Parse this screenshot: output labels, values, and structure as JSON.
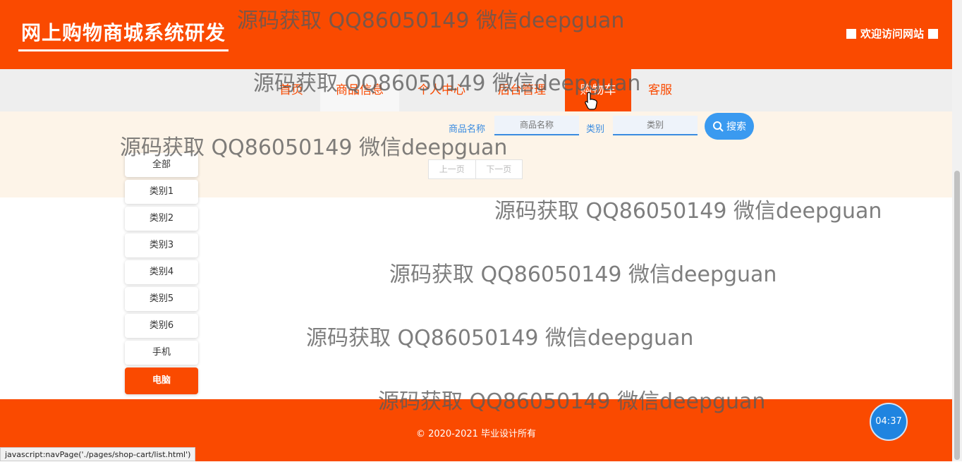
{
  "header": {
    "site_title": "网上购物商城系统研发",
    "welcome": "欢迎访问网站"
  },
  "nav": {
    "items": [
      {
        "label": "首页"
      },
      {
        "label": "商品信息"
      },
      {
        "label": "个人中心"
      },
      {
        "label": "后台管理"
      },
      {
        "label": "购物车"
      },
      {
        "label": "客服"
      }
    ]
  },
  "search": {
    "name_label": "商品名称",
    "name_placeholder": "商品名称",
    "category_label": "类别",
    "category_placeholder": "类别",
    "button_label": "搜索"
  },
  "pager": {
    "prev": "上一页",
    "next": "下一页"
  },
  "categories": [
    "全部",
    "类别1",
    "类别2",
    "类别3",
    "类别4",
    "类别5",
    "类别6",
    "手机",
    "电脑"
  ],
  "footer": {
    "copyright": "© 2020-2021 毕业设计所有"
  },
  "timer": "04:37",
  "status_bar": "javascript:navPage('./pages/shop-cart/list.html')",
  "watermark": "源码获取 QQ86050149 微信deepguan",
  "colors": {
    "brand": "#fa4a00",
    "accent": "#3a9af0"
  }
}
